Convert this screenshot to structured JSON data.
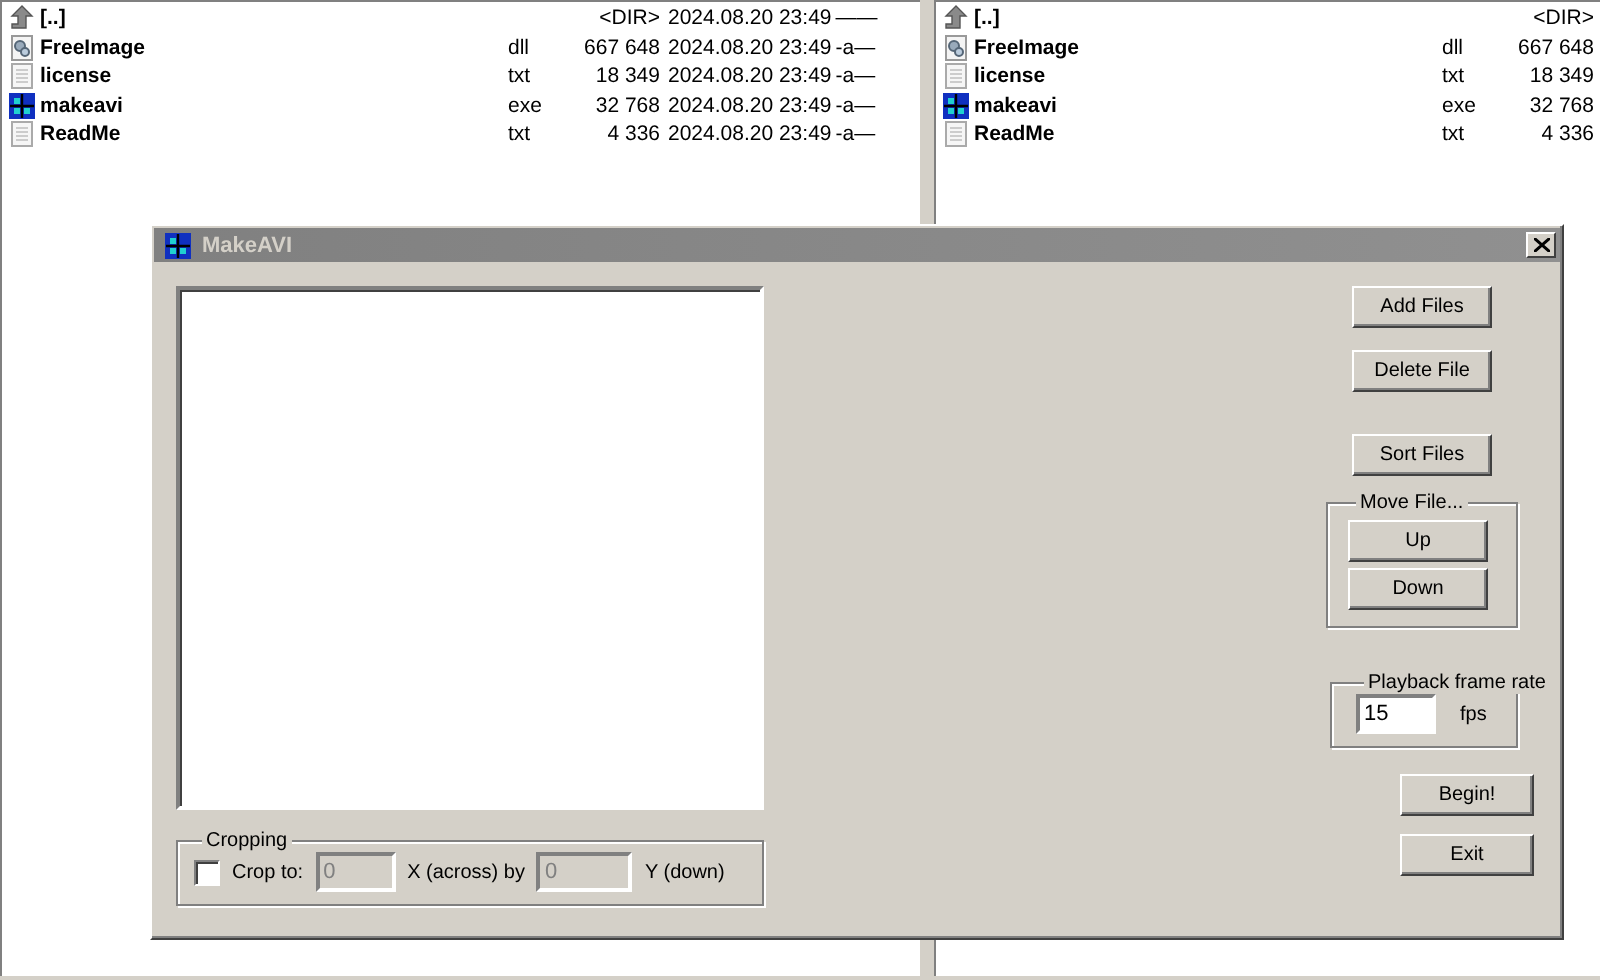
{
  "left_panel": {
    "rows": [
      {
        "kind": "parent",
        "name": "[..]",
        "ext": "",
        "size": "<DIR>",
        "date": "2024.08.20 23:49",
        "attr": "——"
      },
      {
        "kind": "dll",
        "name": "FreeImage",
        "ext": "dll",
        "size": "667 648",
        "date": "2024.08.20 23:49",
        "attr": "-a—"
      },
      {
        "kind": "text",
        "name": "license",
        "ext": "txt",
        "size": "18 349",
        "date": "2024.08.20 23:49",
        "attr": "-a—"
      },
      {
        "kind": "app",
        "name": "makeavi",
        "ext": "exe",
        "size": "32 768",
        "date": "2024.08.20 23:49",
        "attr": "-a—"
      },
      {
        "kind": "text",
        "name": "ReadMe",
        "ext": "txt",
        "size": "4 336",
        "date": "2024.08.20 23:49",
        "attr": "-a—"
      }
    ]
  },
  "right_panel": {
    "rows": [
      {
        "kind": "parent",
        "name": "[..]",
        "ext": "",
        "size": "<DIR>"
      },
      {
        "kind": "dll",
        "name": "FreeImage",
        "ext": "dll",
        "size": "667 648"
      },
      {
        "kind": "text",
        "name": "license",
        "ext": "txt",
        "size": "18 349"
      },
      {
        "kind": "app",
        "name": "makeavi",
        "ext": "exe",
        "size": "32 768"
      },
      {
        "kind": "text",
        "name": "ReadMe",
        "ext": "txt",
        "size": "4 336"
      }
    ]
  },
  "dialog": {
    "title": "MakeAVI",
    "active": false,
    "buttons": [
      "Add Files",
      "Delete File",
      "Sort Files"
    ],
    "move_group": {
      "label": "Move File...",
      "buttons": [
        "Up",
        "Down"
      ]
    },
    "framerate_group": {
      "label": "Playback frame rate",
      "value": "15",
      "unit": "fps"
    },
    "actions": [
      "Begin!",
      "Exit"
    ],
    "cropping": {
      "label": "Cropping",
      "checkbox_label": "Crop to:",
      "checked": false,
      "x_value": "0",
      "x_label": "X (across) by",
      "y_value": "0",
      "y_label": "Y (down)",
      "disabled": true
    }
  }
}
